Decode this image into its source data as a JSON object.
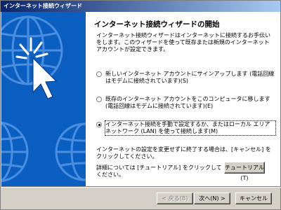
{
  "window": {
    "title": "インターネット接続ウィザード"
  },
  "page": {
    "heading": "インターネット接続ウィザードの開始",
    "intro": "インターネット接続ウィザードはインターネットに接続するお手伝いをします。このウィザードを使って既存または新規のインターネット アカウントが設定できます。",
    "options": [
      {
        "label": "新しいインターネット アカウントにサインアップします (電話回線はモデムに接続されています)(S)",
        "selected": false
      },
      {
        "label": "既存のインターネット アカウントをこのコンピュータに移します (電話回線はモデムに接続されています)(E)",
        "selected": false
      },
      {
        "label": "インターネット接続を手動で設定するか、またはローカル エリア ネットワーク (LAN) を使って接続します(M)",
        "selected": true
      }
    ],
    "cancel_note": "インターネットの設定を変更せずに終了する場合は、[キャンセル] をクリックしてください。",
    "tutorial_note": "詳細については [チュートリアル] をクリックしてください。",
    "tutorial_button": "チュートリアル(T)"
  },
  "footer": {
    "back_button": "< 戻る(B)",
    "next_button": "次へ(N) >",
    "cancel_button": "キャンセル"
  },
  "colors": {
    "title_start": "#0a246a",
    "title_end": "#a6caf0",
    "side_panel": "#0b5fc1"
  }
}
